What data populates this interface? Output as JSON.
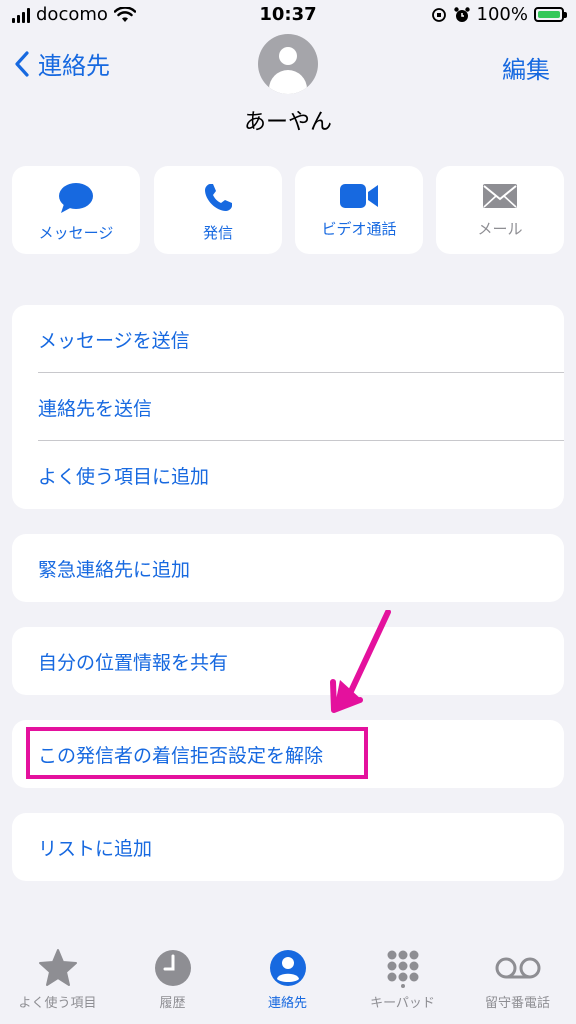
{
  "status_bar": {
    "carrier": "docomo",
    "time": "10:37",
    "battery": "100%"
  },
  "nav": {
    "back_label": "連絡先",
    "edit_label": "編集"
  },
  "contact": {
    "name": "あーやん"
  },
  "actions": [
    {
      "label": "メッセージ",
      "icon": "message-icon"
    },
    {
      "label": "発信",
      "icon": "phone-icon"
    },
    {
      "label": "ビデオ通話",
      "icon": "video-icon"
    },
    {
      "label": "メール",
      "icon": "mail-icon",
      "disabled": true
    }
  ],
  "list_group1": [
    {
      "label": "メッセージを送信"
    },
    {
      "label": "連絡先を送信"
    },
    {
      "label": "よく使う項目に追加"
    }
  ],
  "emergency": {
    "label": "緊急連絡先に追加"
  },
  "share_location": {
    "label": "自分の位置情報を共有"
  },
  "unblock": {
    "label": "この発信者の着信拒否設定を解除"
  },
  "add_to_list": {
    "label": "リストに追加"
  },
  "tabs": [
    {
      "label": "よく使う項目",
      "icon": "star-icon"
    },
    {
      "label": "履歴",
      "icon": "clock-icon"
    },
    {
      "label": "連絡先",
      "icon": "person-icon",
      "active": true
    },
    {
      "label": "キーパッド",
      "icon": "keypad-icon"
    },
    {
      "label": "留守番電話",
      "icon": "voicemail-icon"
    }
  ],
  "colors": {
    "accent": "#1769e0",
    "highlight": "#e4119d",
    "background": "#f2f2f7",
    "inactive": "#8e8e93"
  }
}
